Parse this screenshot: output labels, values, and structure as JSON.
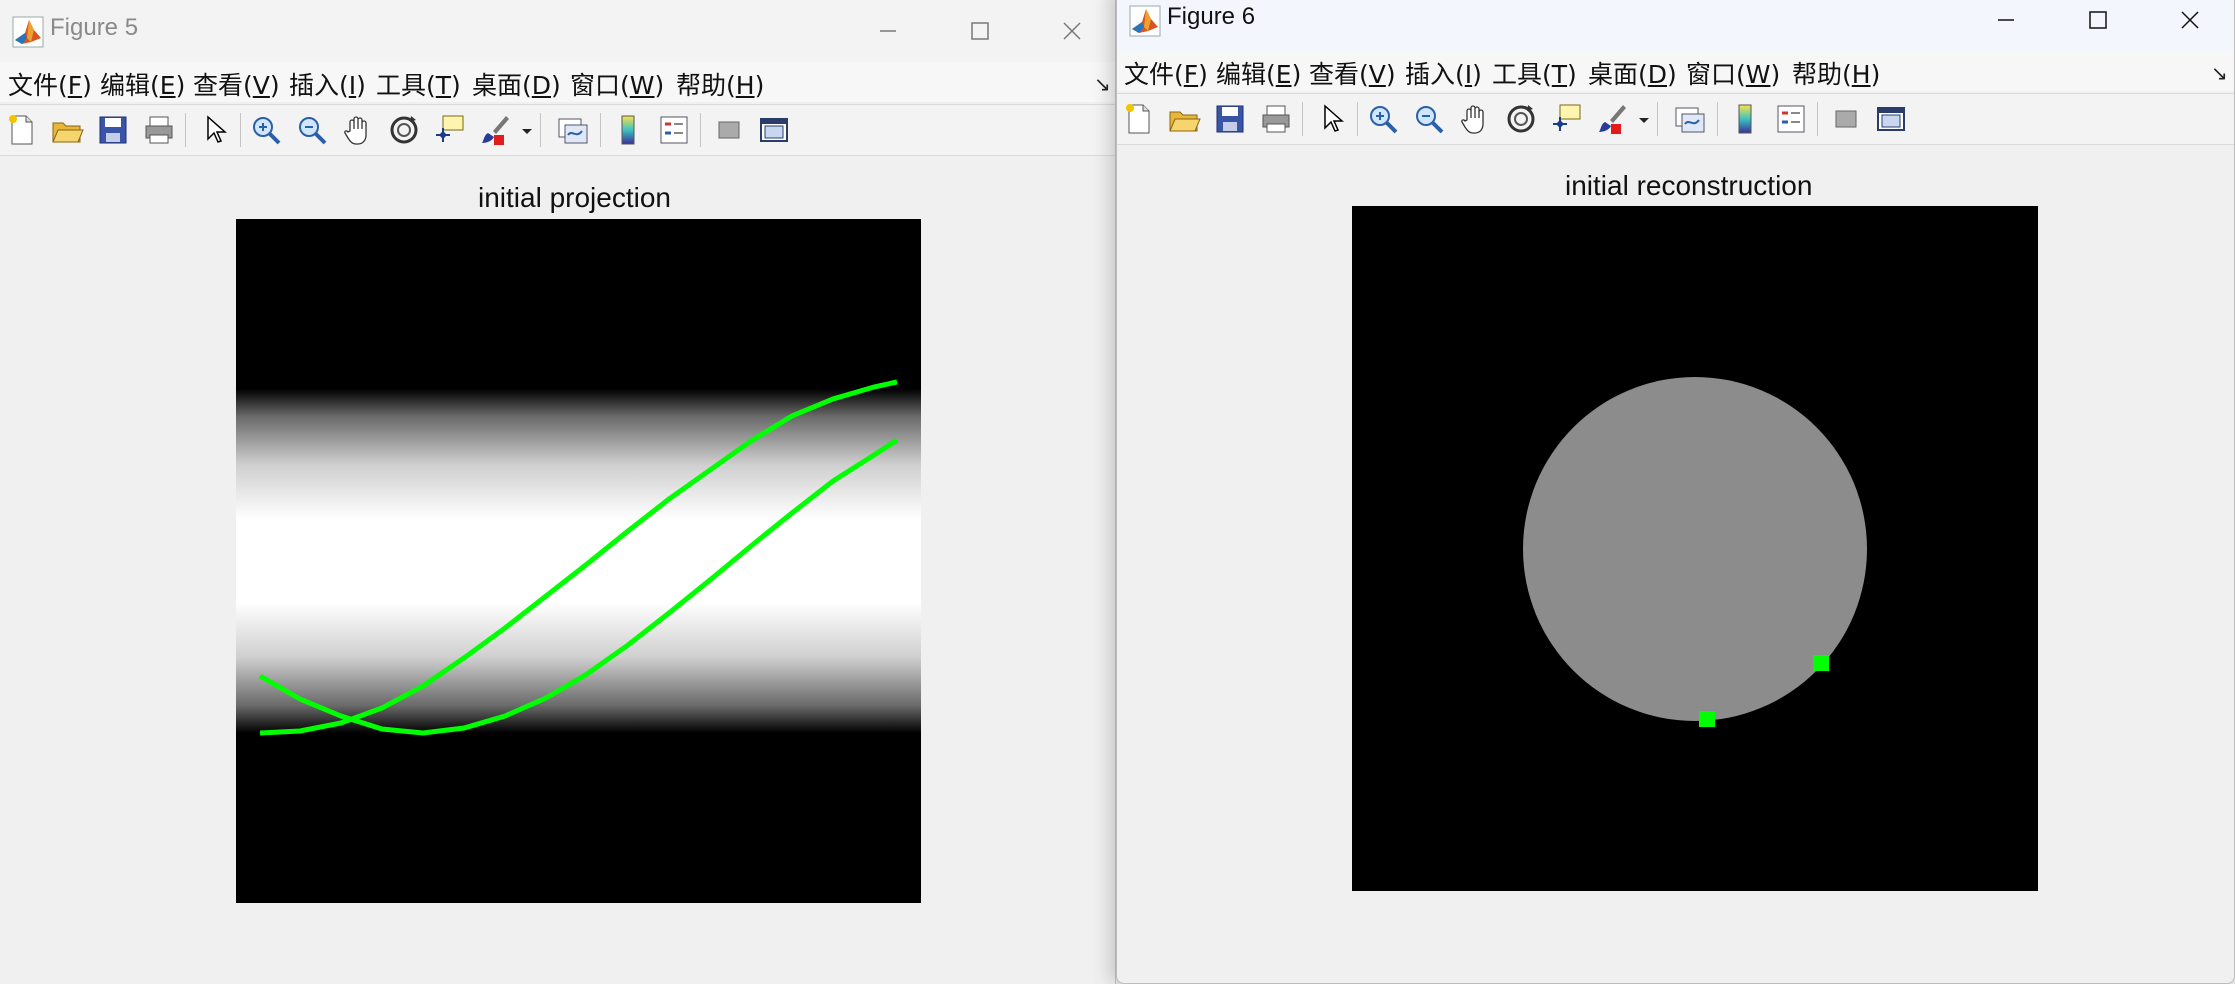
{
  "figure5": {
    "title": "Figure 5",
    "menu": [
      {
        "label": "文件(",
        "key": "F",
        "end": ")"
      },
      {
        "label": "编辑(",
        "key": "E",
        "end": ")"
      },
      {
        "label": "查看(",
        "key": "V",
        "end": ")"
      },
      {
        "label": "插入(",
        "key": "I",
        "end": ")"
      },
      {
        "label": "工具(",
        "key": "T",
        "end": ")"
      },
      {
        "label": "桌面(",
        "key": "D",
        "end": ")"
      },
      {
        "label": "窗口(",
        "key": "W",
        "end": ")"
      },
      {
        "label": "帮助(",
        "key": "H",
        "end": ")"
      }
    ],
    "axes_title": "initial projection"
  },
  "figure6": {
    "title": "Figure 6",
    "menu": [
      {
        "label": "文件(",
        "key": "F",
        "end": ")"
      },
      {
        "label": "编辑(",
        "key": "E",
        "end": ")"
      },
      {
        "label": "查看(",
        "key": "V",
        "end": ")"
      },
      {
        "label": "插入(",
        "key": "I",
        "end": ")"
      },
      {
        "label": "工具(",
        "key": "T",
        "end": ")"
      },
      {
        "label": "桌面(",
        "key": "D",
        "end": ")"
      },
      {
        "label": "窗口(",
        "key": "W",
        "end": ")"
      },
      {
        "label": "帮助(",
        "key": "H",
        "end": ")"
      }
    ],
    "axes_title": "initial reconstruction"
  },
  "toolbar_icons": [
    "new-figure-icon",
    "open-file-icon",
    "save-icon",
    "print-icon",
    "select-arrow-icon",
    "zoom-in-icon",
    "zoom-out-icon",
    "pan-hand-icon",
    "rotate-3d-icon",
    "data-cursor-icon",
    "brush-icon",
    "brush-dropdown-icon",
    "link-plot-icon",
    "colorbar-icon",
    "legend-icon",
    "hide-plot-tools-icon",
    "show-plot-tools-icon"
  ],
  "colors": {
    "curve": "#00ff00",
    "disk": "#8c8c8c",
    "background": "#000000"
  }
}
